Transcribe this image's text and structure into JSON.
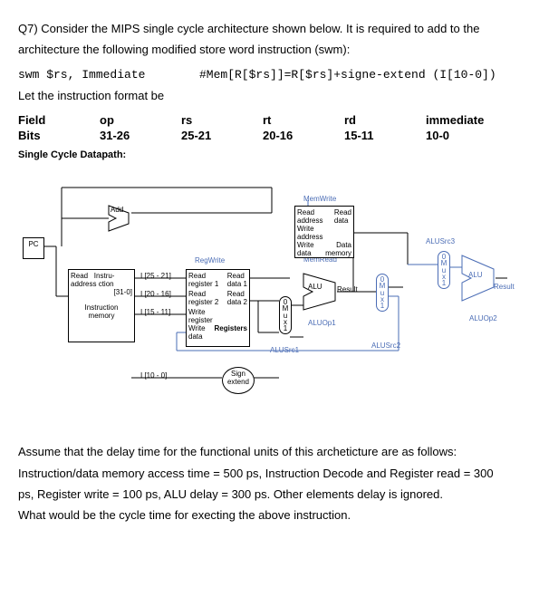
{
  "question_number": "Q7)",
  "question_line1": "Consider the MIPS single cycle architecture shown below. It is required to add to the",
  "question_line2": "architecture the following modified store word instruction (swm):",
  "instr_left": "swm $rs, Immediate",
  "instr_right": "#Mem[R[$rs]]=R[$rs]+signe-extend (I[10-0])",
  "format_intro": "Let the instruction format be",
  "format": {
    "headers": [
      "Field",
      "op",
      "rs",
      "rt",
      "rd",
      "immediate"
    ],
    "bits": [
      "Bits",
      "31-26",
      "25-21",
      "20-16",
      "15-11",
      "10-0"
    ]
  },
  "diagram": {
    "title": "Single Cycle Datapath:",
    "pc": "PC",
    "add": "Add",
    "instr_mem": {
      "l1": "Read",
      "l2": "address",
      "l3": "Instru-",
      "l4": "ction",
      "l5": "[31-0]",
      "l6": "Instruction",
      "l7": "memory"
    },
    "wires": {
      "w1": "I [25 - 21]",
      "w2": "I [20 - 16]",
      "w3": "I [15 - 11]",
      "w4": "I [10 - 0]"
    },
    "regfile": {
      "regwrite": "RegWrite",
      "r1": "Read",
      "r2": "register 1",
      "r3": "Read",
      "r4": "register 2",
      "r5": "Write",
      "r6": "register",
      "r7": "Write",
      "r8": "data",
      "d1": "Read",
      "d2": "data 1",
      "d3": "Read",
      "d4": "data 2",
      "reg": "Registers"
    },
    "signext": {
      "l1": "Sign",
      "l2": "extend"
    },
    "alu1": "ALU",
    "alu2": "ALU",
    "result1": "Result",
    "result2": "Result",
    "datamem": {
      "memwrite": "MemWrite",
      "memread": "MemRead",
      "r1": "Read",
      "r2": "address",
      "r3": "Write",
      "r4": "address",
      "r5": "Write",
      "r6": "data",
      "d1": "Read",
      "d2": "data",
      "mem": "Data",
      "mem2": "memory"
    },
    "mux": "M\nu\nx",
    "mux0": "0",
    "mux1": "1",
    "ctrl": {
      "alusrc1": "ALUSrc1",
      "alusrc2": "ALUSrc2",
      "alusrc3": "ALUSrc3",
      "aluop1": "ALUOp1",
      "aluop2": "ALUOp2"
    }
  },
  "bottom": {
    "l1": "Assume that the delay time for the functional units of this archeticture are as follows:",
    "l2": "Instruction/data memory access time = 500 ps, Instruction Decode and Register read = 300",
    "l3": "ps, Register write = 100 ps, ALU delay = 300 ps. Other elements delay is ignored.",
    "l4": "What would be the cycle time for execting the above instruction."
  }
}
